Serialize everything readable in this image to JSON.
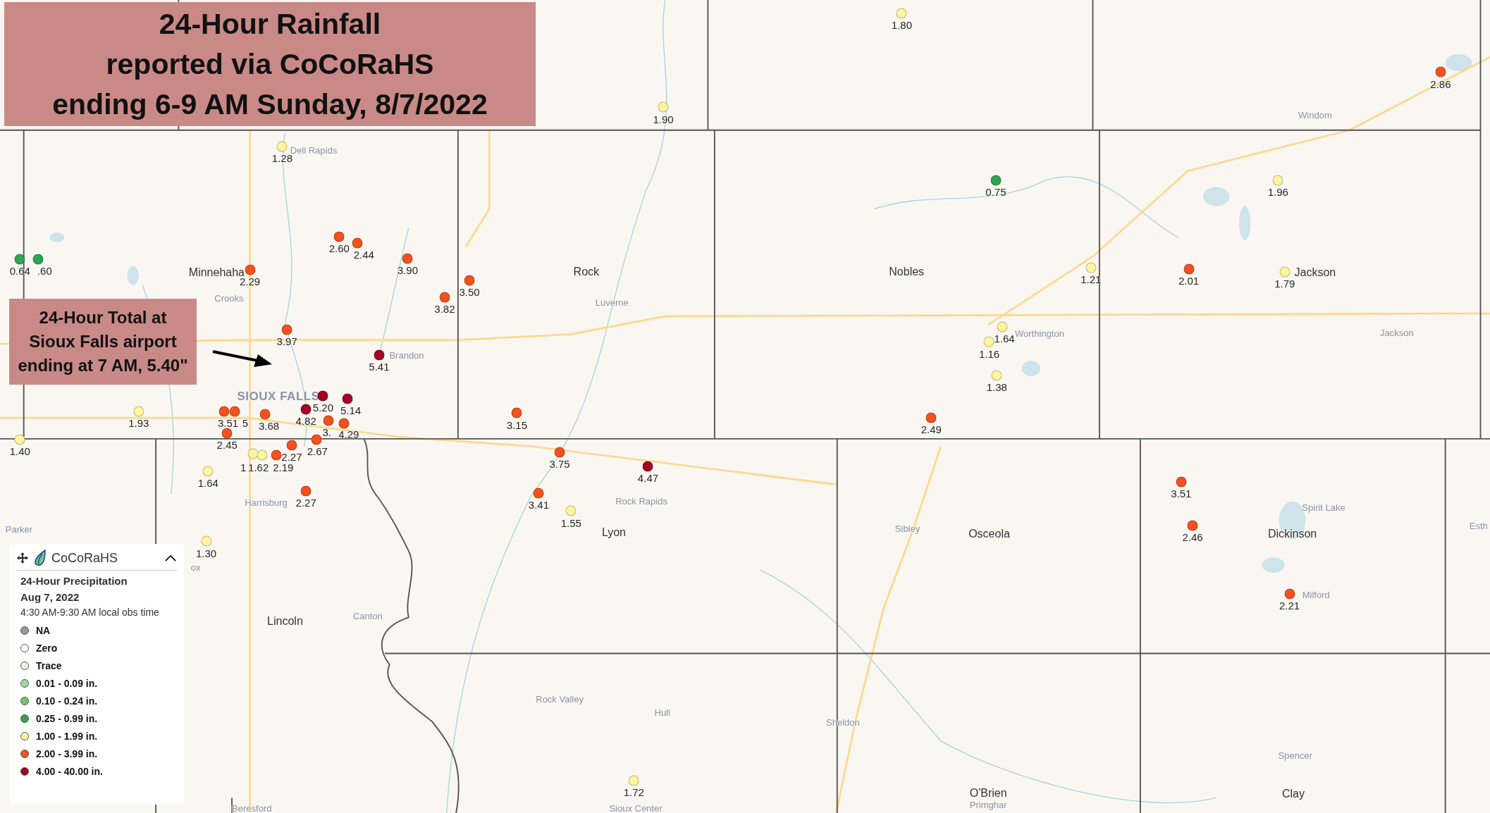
{
  "title_banner": {
    "lines": [
      "24-Hour Rainfall",
      "reported via CoCoRaHS",
      "ending 6-9 AM Sunday, 8/7/2022"
    ]
  },
  "callout": {
    "lines": [
      "24-Hour Total at",
      "Sioux Falls airport",
      "ending at 7 AM, 5.40\""
    ]
  },
  "places": [
    {
      "name": "Windom",
      "kind": "town"
    },
    {
      "name": "Dell Rapids",
      "kind": "town"
    },
    {
      "name": "Minnehaha",
      "kind": "county"
    },
    {
      "name": "Rock",
      "kind": "county"
    },
    {
      "name": "Nobles",
      "kind": "county"
    },
    {
      "name": "Jackson",
      "kind": "county"
    },
    {
      "name": "Crooks",
      "kind": "town"
    },
    {
      "name": "Luverne",
      "kind": "town"
    },
    {
      "name": "Worthington",
      "kind": "town"
    },
    {
      "name": "Jackson",
      "kind": "town"
    },
    {
      "name": "Brandon",
      "kind": "town"
    },
    {
      "name": "SIOUX FALLS",
      "kind": "city"
    },
    {
      "name": "Harrisburg",
      "kind": "town"
    },
    {
      "name": "Rock Rapids",
      "kind": "town"
    },
    {
      "name": "Spirit Lake",
      "kind": "town"
    },
    {
      "name": "Parker",
      "kind": "town"
    },
    {
      "name": "Lyon",
      "kind": "county"
    },
    {
      "name": "Sibley",
      "kind": "town"
    },
    {
      "name": "Osceola",
      "kind": "county"
    },
    {
      "name": "Dickinson",
      "kind": "county"
    },
    {
      "name": "Esth",
      "kind": "town"
    },
    {
      "name": "ox",
      "kind": "town"
    },
    {
      "name": "Milford",
      "kind": "town"
    },
    {
      "name": "Lincoln",
      "kind": "county"
    },
    {
      "name": "Canton",
      "kind": "town"
    },
    {
      "name": "Rock Valley",
      "kind": "town"
    },
    {
      "name": "Hull",
      "kind": "town"
    },
    {
      "name": "Sheldon",
      "kind": "town"
    },
    {
      "name": "Spencer",
      "kind": "town"
    },
    {
      "name": "O'Brien",
      "kind": "county"
    },
    {
      "name": "Clay",
      "kind": "county"
    },
    {
      "name": "Beresford",
      "kind": "town"
    },
    {
      "name": "Sioux Center",
      "kind": "town"
    },
    {
      "name": "Primghar",
      "kind": "town"
    }
  ],
  "stations": [
    {
      "value": "1.80",
      "color": "#fff59d"
    },
    {
      "value": "2.86",
      "color": "#f4511e"
    },
    {
      "value": "1.90",
      "color": "#fff59d"
    },
    {
      "value": "1.28",
      "color": "#fff59d"
    },
    {
      "value": "0.75",
      "color": "#31a354"
    },
    {
      "value": "1.96",
      "color": "#fff59d"
    },
    {
      "value": "2.60",
      "color": "#f4511e"
    },
    {
      "value": "2.44",
      "color": "#f4511e"
    },
    {
      "value": "0.64",
      "color": "#31a354"
    },
    {
      "value": ".60",
      "color": "#31a354"
    },
    {
      "value": "3.90",
      "color": "#f4511e"
    },
    {
      "value": "2.29",
      "color": "#f4511e"
    },
    {
      "value": "1.21",
      "color": "#fff59d"
    },
    {
      "value": "2.01",
      "color": "#f4511e"
    },
    {
      "value": "1.79",
      "color": "#fff59d"
    },
    {
      "value": "3.50",
      "color": "#f4511e"
    },
    {
      "value": "3.82",
      "color": "#f4511e"
    },
    {
      "value": "3.97",
      "color": "#f4511e"
    },
    {
      "value": "1.64",
      "color": "#fff59d"
    },
    {
      "value": "1.16",
      "color": "#fff59d"
    },
    {
      "value": "5.41",
      "color": "#a50026"
    },
    {
      "value": "1.38",
      "color": "#fff59d"
    },
    {
      "value": "5.20",
      "color": "#a50026"
    },
    {
      "value": "5.14",
      "color": "#a50026"
    },
    {
      "value": "1.93",
      "color": "#fff59d"
    },
    {
      "value": "3.51",
      "color": "#f4511e"
    },
    {
      "value": "5",
      "color": "#f4511e"
    },
    {
      "value": "3.68",
      "color": "#f4511e"
    },
    {
      "value": "4.82",
      "color": "#a50026"
    },
    {
      "value": "3.",
      "color": "#f4511e"
    },
    {
      "value": "4.29",
      "color": "#f4511e"
    },
    {
      "value": "3.15",
      "color": "#f4511e"
    },
    {
      "value": "2.49",
      "color": "#f4511e"
    },
    {
      "value": "1.40",
      "color": "#fff59d"
    },
    {
      "value": "2.45",
      "color": "#f4511e"
    },
    {
      "value": "2.67",
      "color": "#f4511e"
    },
    {
      "value": "1",
      "color": "#fff59d"
    },
    {
      "value": "1.62",
      "color": "#fff59d"
    },
    {
      "value": "2.19",
      "color": "#f4511e"
    },
    {
      "value": "2.27",
      "color": "#f4511e"
    },
    {
      "value": "3.75",
      "color": "#f4511e"
    },
    {
      "value": "1.64",
      "color": "#fff59d"
    },
    {
      "value": "4.47",
      "color": "#a50026"
    },
    {
      "value": "3.51",
      "color": "#f4511e"
    },
    {
      "value": "2.27",
      "color": "#f4511e"
    },
    {
      "value": "3.41",
      "color": "#f4511e"
    },
    {
      "value": "1.55",
      "color": "#fff59d"
    },
    {
      "value": "2.46",
      "color": "#f4511e"
    },
    {
      "value": "1.30",
      "color": "#fff59d"
    },
    {
      "value": "2.21",
      "color": "#f4511e"
    },
    {
      "value": "1.72",
      "color": "#fff59d"
    }
  ],
  "legend": {
    "brand": "CoCoRaHS",
    "title": "24-Hour Precipitation",
    "date": "Aug 7, 2022",
    "subtitle": "4:30 AM-9:30 AM local obs time",
    "items": [
      {
        "label": "NA",
        "color": "#999999"
      },
      {
        "label": "Zero",
        "color": "#ffffff"
      },
      {
        "label": "Trace",
        "color": "#e5f5e0"
      },
      {
        "label": "0.01 - 0.09 in.",
        "color": "#a1d99b"
      },
      {
        "label": "0.10 - 0.24 in.",
        "color": "#74c476"
      },
      {
        "label": "0.25 - 0.99 in.",
        "color": "#31a354"
      },
      {
        "label": "1.00 - 1.99 in.",
        "color": "#fff59d"
      },
      {
        "label": "2.00 - 3.99 in.",
        "color": "#f4511e"
      },
      {
        "label": "4.00 - 40.00 in.",
        "color": "#a50026"
      }
    ]
  }
}
